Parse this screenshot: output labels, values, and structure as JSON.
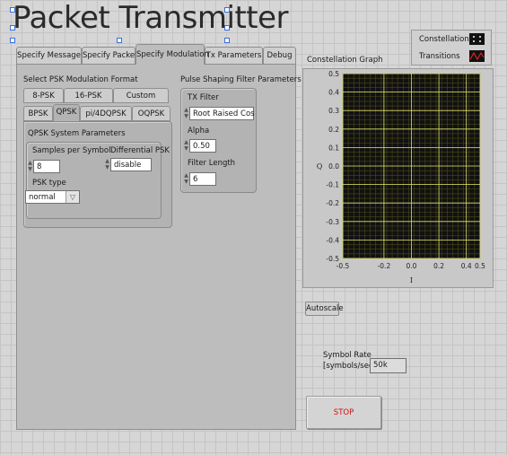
{
  "title": "Packet Transmitter",
  "tabs": [
    {
      "label": "Specify Message",
      "active": false
    },
    {
      "label": "Specify Packet",
      "active": false
    },
    {
      "label": "Specify Modulation",
      "active": true
    },
    {
      "label": "Tx Parameters",
      "active": false
    },
    {
      "label": "Debug",
      "active": false
    }
  ],
  "modulation": {
    "format_label": "Select PSK Modulation Format",
    "format_tabs_row1": [
      "8-PSK",
      "16-PSK",
      "Custom"
    ],
    "format_tabs_row2": [
      "BPSK",
      "QPSK",
      "pi/4DQPSK",
      "OQPSK"
    ],
    "active_format": "QPSK",
    "qpsk_group_label": "QPSK System Parameters",
    "samples_label": "Samples per Symbol",
    "samples_value": "8",
    "differential_label": "Differential PSK",
    "differential_value": "disable",
    "psk_type_label": "PSK type",
    "psk_type_value": "normal"
  },
  "pulse_shaping": {
    "label": "Pulse Shaping Filter Parameters",
    "tx_filter_label": "TX Filter",
    "tx_filter_value": "Root Raised Cos",
    "alpha_label": "Alpha",
    "alpha_value": "0.50",
    "filter_length_label": "Filter Length",
    "filter_length_value": "6"
  },
  "graph": {
    "label": "Constellation Graph",
    "legend": [
      {
        "name": "Constellation",
        "icon": "dots-icon"
      },
      {
        "name": "Transitions",
        "icon": "line-icon"
      }
    ],
    "plot_bg": "#111111",
    "grid_color": "#e1e16a",
    "xlabel": "I",
    "ylabel": "Q",
    "yticks": [
      "0.5",
      "0.4",
      "0.3",
      "0.2",
      "0.1",
      "0.0",
      "-0.1",
      "-0.2",
      "-0.3",
      "-0.4",
      "-0.5"
    ],
    "xticks": [
      "-0.5",
      "-0.2",
      "0.0",
      "0.2",
      "0.4",
      "0.5"
    ],
    "autoscale_label": "Autoscale"
  },
  "symbol_rate": {
    "label_line1": "Symbol Rate",
    "label_line2": "[symbols/sec]",
    "value": "50k"
  },
  "stop_label": "STOP"
}
